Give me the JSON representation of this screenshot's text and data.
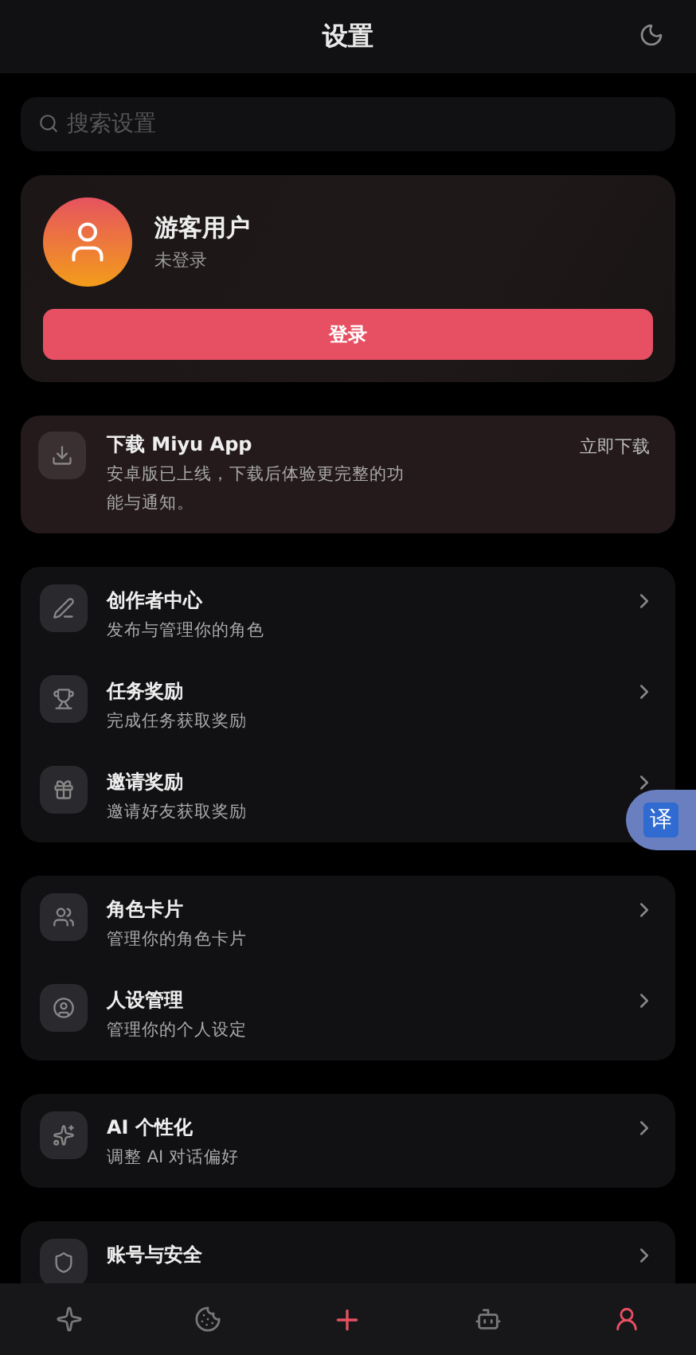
{
  "header": {
    "title": "设置"
  },
  "search": {
    "placeholder": "搜索设置"
  },
  "profile": {
    "name": "游客用户",
    "status": "未登录",
    "login_button": "登录"
  },
  "download": {
    "title": "下载 Miyu App",
    "description": "安卓版已上线，下载后体验更完整的功能与通知。",
    "action": "立即下载"
  },
  "groups": [
    {
      "items": [
        {
          "title": "创作者中心",
          "subtitle": "发布与管理你的角色"
        },
        {
          "title": "任务奖励",
          "subtitle": "完成任务获取奖励"
        },
        {
          "title": "邀请奖励",
          "subtitle": "邀请好友获取奖励"
        }
      ]
    },
    {
      "items": [
        {
          "title": "角色卡片",
          "subtitle": "管理你的角色卡片"
        },
        {
          "title": "人设管理",
          "subtitle": "管理你的个人设定"
        }
      ]
    },
    {
      "items": [
        {
          "title": "AI 个性化",
          "subtitle": "调整 AI 对话偏好"
        }
      ]
    },
    {
      "items": [
        {
          "title": "账号与安全"
        }
      ]
    }
  ],
  "translate_button": {
    "label": "译"
  },
  "nav": [
    {
      "kind": "tab",
      "selected": false
    },
    {
      "kind": "tab",
      "selected": false
    },
    {
      "kind": "create"
    },
    {
      "kind": "tab",
      "selected": false
    },
    {
      "kind": "tab",
      "selected": true
    }
  ]
}
